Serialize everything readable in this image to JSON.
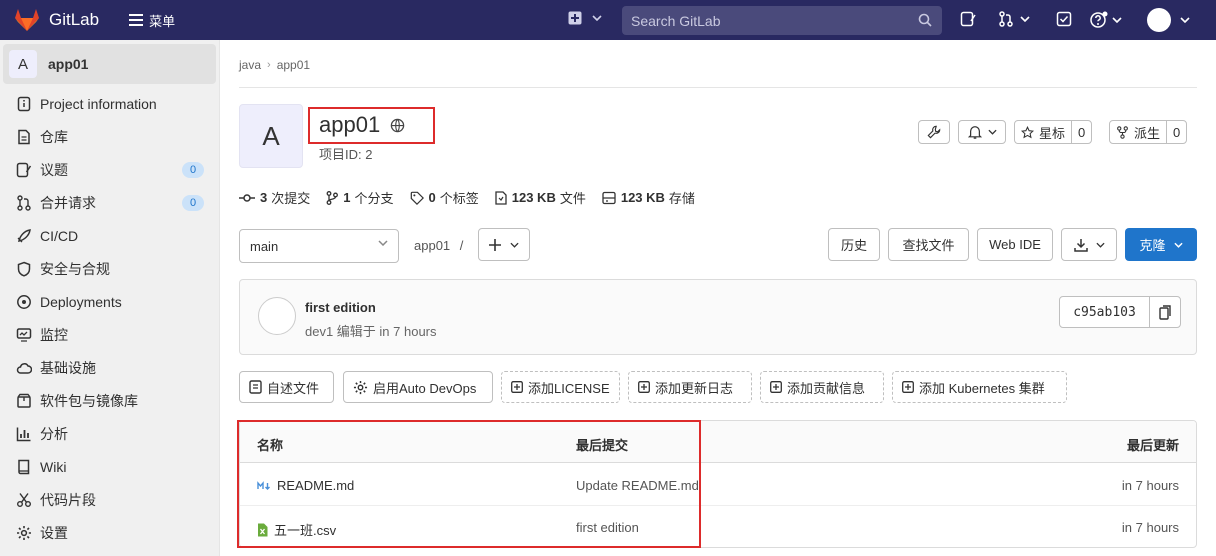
{
  "navbar": {
    "brand": "GitLab",
    "menu_label": "菜单",
    "search_placeholder": "Search GitLab"
  },
  "sidebar": {
    "project_avatar_letter": "A",
    "project_name": "app01",
    "items": [
      {
        "label": "Project information"
      },
      {
        "label": "仓库"
      },
      {
        "label": "议题",
        "badge": "0"
      },
      {
        "label": "合并请求",
        "badge": "0"
      },
      {
        "label": "CI/CD"
      },
      {
        "label": "安全与合规"
      },
      {
        "label": "Deployments"
      },
      {
        "label": "监控"
      },
      {
        "label": "基础设施"
      },
      {
        "label": "软件包与镜像库"
      },
      {
        "label": "分析"
      },
      {
        "label": "Wiki"
      },
      {
        "label": "代码片段"
      },
      {
        "label": "设置"
      }
    ]
  },
  "breadcrumb": [
    "java",
    "app01"
  ],
  "project": {
    "avatar_letter": "A",
    "name": "app01",
    "id_label": "项目ID: 2",
    "star_label": "星标",
    "star_count": "0",
    "fork_label": "派生",
    "fork_count": "0"
  },
  "stats": {
    "commits_count": "3",
    "commits_label": "次提交",
    "branches_count": "1",
    "branches_label": "个分支",
    "tags_count": "0",
    "tags_label": "个标签",
    "files_size": "123 KB",
    "files_label": "文件",
    "storage_size": "123 KB",
    "storage_label": "存储"
  },
  "repo_bar": {
    "branch": "main",
    "path": "app01",
    "path_sep": "/",
    "history": "历史",
    "find_file": "查找文件",
    "web_ide": "Web IDE",
    "clone": "克隆"
  },
  "last_commit": {
    "title": "first edition",
    "meta": "dev1 编辑于 in 7 hours",
    "sha": "c95ab103"
  },
  "quick_actions": [
    {
      "label": "自述文件",
      "dashed": false
    },
    {
      "label": "启用Auto DevOps",
      "dashed": false
    },
    {
      "label": "添加LICENSE",
      "dashed": true
    },
    {
      "label": "添加更新日志",
      "dashed": true
    },
    {
      "label": "添加贡献信息",
      "dashed": true
    },
    {
      "label": "添加 Kubernetes 集群",
      "dashed": true
    }
  ],
  "file_table": {
    "headers": [
      "名称",
      "最后提交",
      "最后更新"
    ],
    "rows": [
      {
        "name": "README.md",
        "commit": "Update README.md",
        "updated": "in 7 hours"
      },
      {
        "name": "五一班.csv",
        "commit": "first edition",
        "updated": "in 7 hours"
      }
    ]
  }
}
